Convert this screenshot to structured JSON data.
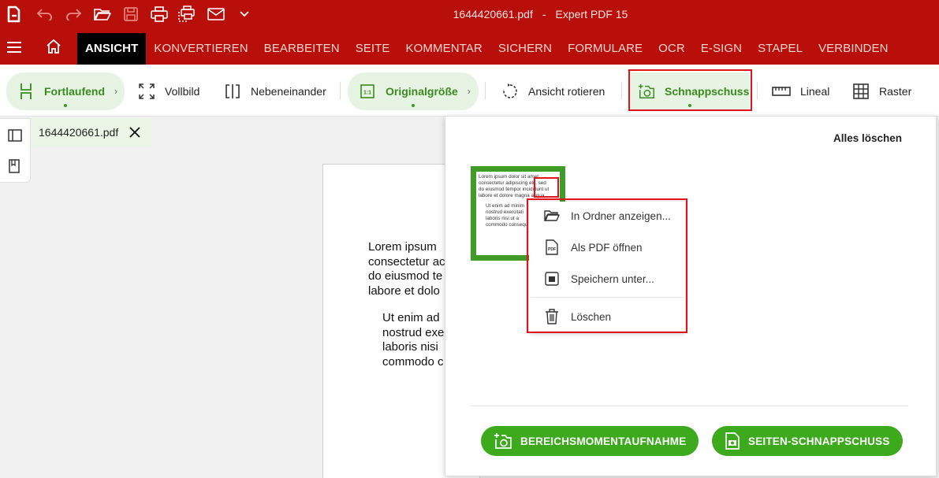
{
  "window": {
    "filename": "1644420661.pdf",
    "separator": "-",
    "app_name": "Expert PDF 15"
  },
  "menu": {
    "tabs": [
      "ANSICHT",
      "KONVERTIEREN",
      "BEARBEITEN",
      "SEITE",
      "KOMMENTAR",
      "SICHERN",
      "FORMULARE",
      "OCR",
      "E-SIGN",
      "STAPEL",
      "VERBINDEN"
    ],
    "active_tab": "ANSICHT"
  },
  "ribbon": {
    "fortlaufend": "Fortlaufend",
    "vollbild": "Vollbild",
    "nebeneinander": "Nebeneinander",
    "originalgroesse": "Originalgröße",
    "ansicht_rotieren": "Ansicht rotieren",
    "schnappschuss": "Schnappschuss",
    "lineal": "Lineal",
    "raster": "Raster"
  },
  "doc_tab": {
    "label": "1644420661.pdf"
  },
  "document": {
    "lines_a": [
      "Lorem ipsum",
      "consectetur ac",
      "do eiusmod te",
      "labore et dolo"
    ],
    "lines_b": [
      "Ut enim ad",
      "nostrud exe",
      "laboris nisi",
      "commodo c"
    ]
  },
  "panel": {
    "clear_all": "Alles löschen",
    "thumb_lines_a": [
      "Lorem ipsum dolor sit amet,",
      "consectetur adipiscing elit, sed",
      "do eiusmod tempor incididunt ut",
      "labore et dolore magna aliqua."
    ],
    "thumb_lines_b": [
      "Ut enim ad minim",
      "nostrud exercitati",
      "laboris nisi ut a",
      "commodo consequ"
    ],
    "btn_area": "BEREICHSMOMENTAUFNAHME",
    "btn_page": "SEITEN-SCHNAPPSCHUSS"
  },
  "context_menu": {
    "show_in_folder": "In Ordner anzeigen...",
    "open_as_pdf": "Als PDF öffnen",
    "save_as": "Speichern unter...",
    "delete": "Löschen"
  },
  "colors": {
    "brand_red": "#b80f0a",
    "accent_green": "#3daa1e",
    "highlight_red": "#e1141b"
  }
}
